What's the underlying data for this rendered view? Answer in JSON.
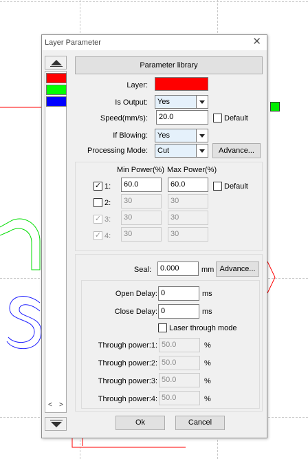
{
  "dialog": {
    "title": "Layer Parameter",
    "close_glyph": "✕"
  },
  "layer_list": {
    "layers": [
      {
        "color": "#ff0000"
      },
      {
        "color": "#00ff00"
      },
      {
        "color": "#0000ff"
      }
    ],
    "scroll_left": "<",
    "scroll_right": ">"
  },
  "params": {
    "library_button": "Parameter library",
    "layer_label": "Layer:",
    "layer_color": "#ff0000",
    "is_output_label": "Is Output:",
    "is_output_value": "Yes",
    "speed_label": "Speed(mm/s):",
    "speed_value": "20.0",
    "speed_default_label": "Default",
    "if_blowing_label": "If Blowing:",
    "if_blowing_value": "Yes",
    "processing_mode_label": "Processing Mode:",
    "processing_mode_value": "Cut",
    "advance_button": "Advance..."
  },
  "power": {
    "min_header": "Min Power(%)",
    "max_header": "Max Power(%)",
    "default_label": "Default",
    "rows": [
      {
        "label": "1:",
        "checked": "✓",
        "min": "60.0",
        "max": "60.0"
      },
      {
        "label": "2:",
        "checked": "",
        "min": "30",
        "max": "30"
      },
      {
        "label": "3:",
        "checked": "✓",
        "min": "30",
        "max": "30"
      },
      {
        "label": "4:",
        "checked": "✓",
        "min": "30",
        "max": "30"
      }
    ]
  },
  "seal": {
    "label": "Seal:",
    "value": "0.000",
    "unit": "mm",
    "advance_button": "Advance...",
    "open_delay_label": "Open Delay:",
    "open_delay_value": "0",
    "open_delay_unit": "ms",
    "close_delay_label": "Close Delay:",
    "close_delay_value": "0",
    "close_delay_unit": "ms",
    "laser_through_label": "Laser through mode",
    "through": [
      {
        "label": "Through power:1:",
        "value": "50.0",
        "unit": "%"
      },
      {
        "label": "Through power:2:",
        "value": "50.0",
        "unit": "%"
      },
      {
        "label": "Through power:3:",
        "value": "50.0",
        "unit": "%"
      },
      {
        "label": "Through power:4:",
        "value": "50.0",
        "unit": "%"
      }
    ]
  },
  "footer": {
    "ok": "Ok",
    "cancel": "Cancel"
  }
}
